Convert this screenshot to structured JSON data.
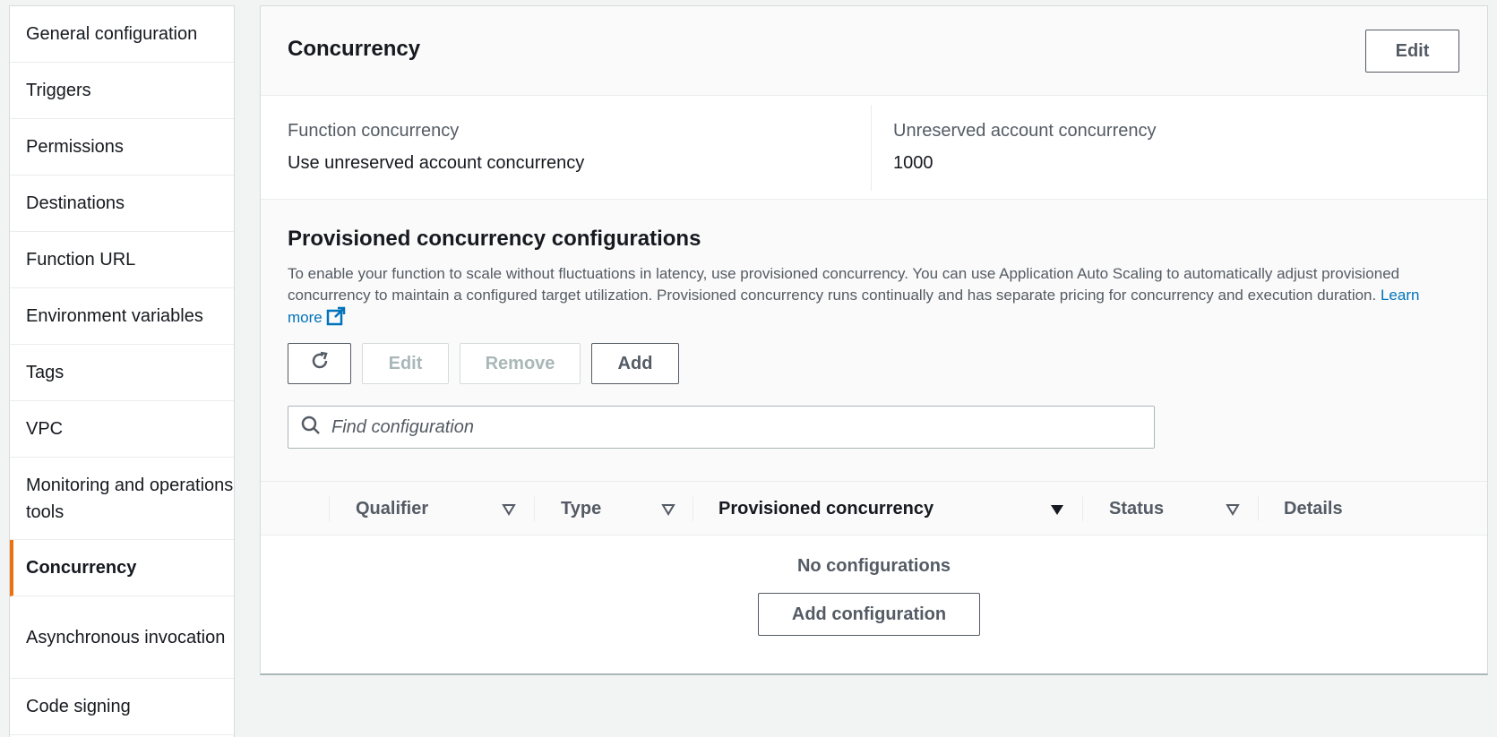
{
  "sidebar": {
    "items": [
      {
        "label": "General configuration"
      },
      {
        "label": "Triggers"
      },
      {
        "label": "Permissions"
      },
      {
        "label": "Destinations"
      },
      {
        "label": "Function URL"
      },
      {
        "label": "Environment variables"
      },
      {
        "label": "Tags"
      },
      {
        "label": "VPC"
      },
      {
        "label": "Monitoring and operations tools"
      },
      {
        "label": "Concurrency",
        "active": true
      },
      {
        "label": "Asynchronous invocation"
      },
      {
        "label": "Code signing"
      }
    ]
  },
  "concurrency": {
    "title": "Concurrency",
    "edit_label": "Edit",
    "function_concurrency_label": "Function concurrency",
    "function_concurrency_value": "Use unreserved account concurrency",
    "unreserved_label": "Unreserved account concurrency",
    "unreserved_value": "1000"
  },
  "provisioned": {
    "title": "Provisioned concurrency configurations",
    "description": "To enable your function to scale without fluctuations in latency, use provisioned concurrency. You can use Application Auto Scaling to automatically adjust provisioned concurrency to maintain a configured target utilization. Provisioned concurrency runs continually and has separate pricing for concurrency and execution duration.",
    "learn_more": "Learn more",
    "toolbar": {
      "edit_label": "Edit",
      "remove_label": "Remove",
      "add_label": "Add"
    },
    "search_placeholder": "Find configuration",
    "columns": [
      "Qualifier",
      "Type",
      "Provisioned concurrency",
      "Status",
      "Details"
    ],
    "empty_text": "No configurations",
    "add_configuration_label": "Add configuration"
  },
  "colors": {
    "accent": "#ec7211",
    "link": "#0073bb",
    "text_secondary": "#545b64"
  }
}
